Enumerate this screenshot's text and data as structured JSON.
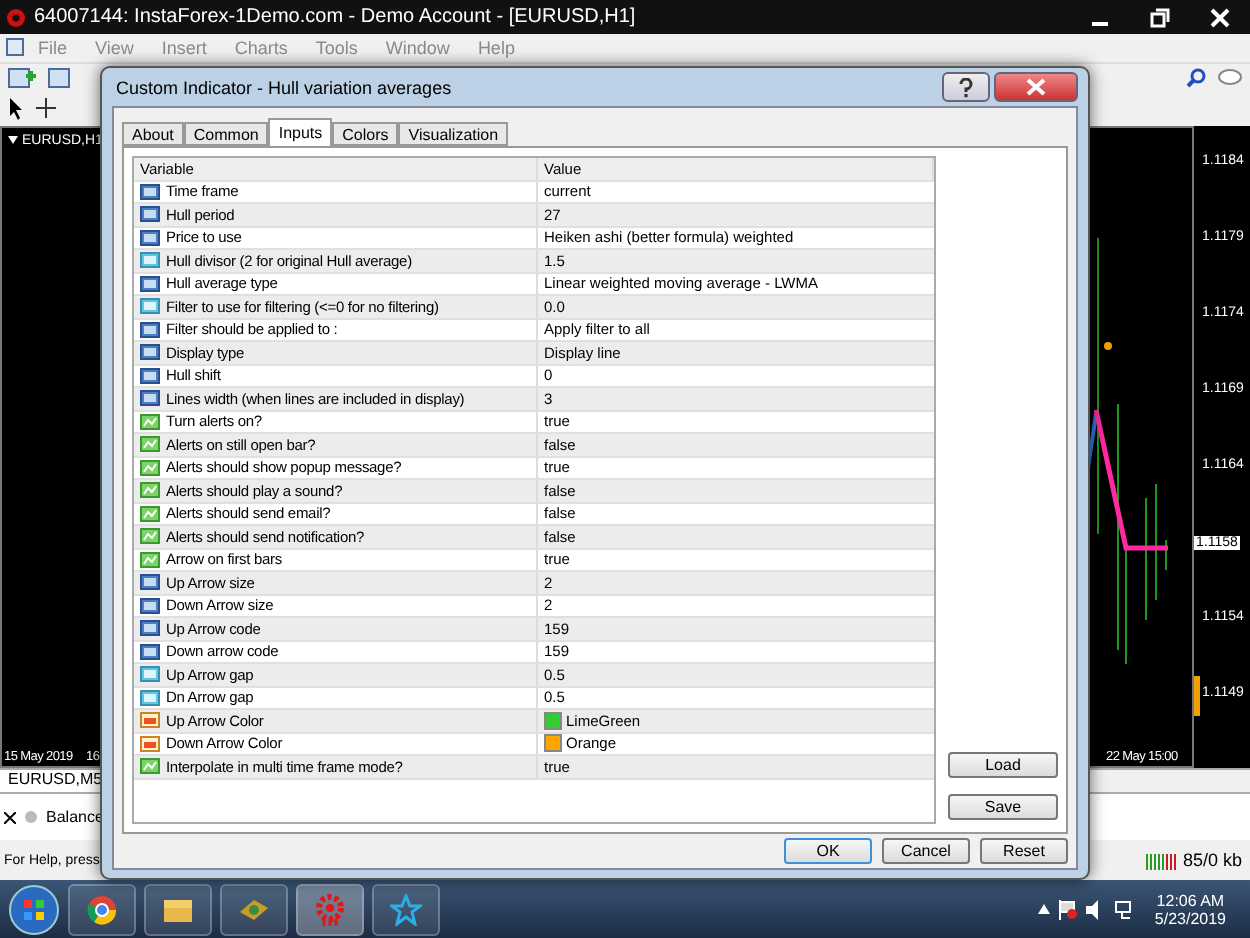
{
  "window": {
    "title": "64007144: InstaForex-1Demo.com - Demo Account - [EURUSD,H1]"
  },
  "menu": [
    "File",
    "View",
    "Insert",
    "Charts",
    "Tools",
    "Window",
    "Help"
  ],
  "chart": {
    "title": "EURUSD,H1",
    "price_scale": [
      "1.1184",
      "1.1179",
      "1.1174",
      "1.1169",
      "1.1164",
      "1.1154",
      "1.1149"
    ],
    "current_price": "1.1158",
    "dates": [
      "15 May 2019",
      "16",
      "22 May 15:00"
    ]
  },
  "chart_tabs": [
    {
      "label": "EURUSD,M5",
      "selected": true
    }
  ],
  "terminal": {
    "balance": "Balance"
  },
  "status_bar": {
    "help": "For Help, press",
    "traffic": "85/0 kb"
  },
  "dialog": {
    "title": "Custom Indicator - Hull variation averages",
    "tabs": [
      {
        "label": "About",
        "selected": false
      },
      {
        "label": "Common",
        "selected": false
      },
      {
        "label": "Inputs",
        "selected": true
      },
      {
        "label": "Colors",
        "selected": false
      },
      {
        "label": "Visualization",
        "selected": false
      }
    ],
    "columns": [
      "Variable",
      "Value"
    ],
    "rows": [
      {
        "kind": "int",
        "variable": "Time frame",
        "value": "current"
      },
      {
        "kind": "int",
        "variable": "Hull period",
        "value": "27"
      },
      {
        "kind": "int",
        "variable": "Price to use",
        "value": "Heiken ashi (better formula) weighted"
      },
      {
        "kind": "double",
        "variable": "Hull divisor (2 for original Hull average)",
        "value": "1.5"
      },
      {
        "kind": "int",
        "variable": "Hull average type",
        "value": "Linear weighted moving average - LWMA"
      },
      {
        "kind": "double",
        "variable": "Filter to use for filtering (<=0 for no filtering)",
        "value": "0.0"
      },
      {
        "kind": "int",
        "variable": "Filter should be applied to :",
        "value": "Apply filter to all"
      },
      {
        "kind": "int",
        "variable": "Display type",
        "value": "Display line"
      },
      {
        "kind": "int",
        "variable": "Hull shift",
        "value": "0"
      },
      {
        "kind": "int",
        "variable": "Lines width (when lines are included in display)",
        "value": "3"
      },
      {
        "kind": "bool",
        "variable": "Turn alerts on?",
        "value": "true"
      },
      {
        "kind": "bool",
        "variable": "Alerts on still open bar?",
        "value": "false"
      },
      {
        "kind": "bool",
        "variable": "Alerts should show popup message?",
        "value": "true"
      },
      {
        "kind": "bool",
        "variable": "Alerts should play a sound?",
        "value": "false"
      },
      {
        "kind": "bool",
        "variable": "Alerts should send email?",
        "value": "false"
      },
      {
        "kind": "bool",
        "variable": "Alerts should send notification?",
        "value": "false"
      },
      {
        "kind": "bool",
        "variable": "Arrow on first bars",
        "value": "true"
      },
      {
        "kind": "int",
        "variable": "Up Arrow size",
        "value": "2"
      },
      {
        "kind": "int",
        "variable": "Down Arrow size",
        "value": "2"
      },
      {
        "kind": "int",
        "variable": "Up Arrow code",
        "value": "159"
      },
      {
        "kind": "int",
        "variable": "Down arrow code",
        "value": "159"
      },
      {
        "kind": "double",
        "variable": "Up Arrow gap",
        "value": "0.5"
      },
      {
        "kind": "double",
        "variable": "Dn Arrow gap",
        "value": "0.5"
      },
      {
        "kind": "color",
        "variable": "Up Arrow Color",
        "value": "LimeGreen",
        "color": "#32cd32"
      },
      {
        "kind": "color",
        "variable": "Down Arrow Color",
        "value": "Orange",
        "color": "#ffa500"
      },
      {
        "kind": "bool",
        "variable": "Interpolate in multi time frame mode?",
        "value": "true"
      }
    ],
    "side_buttons": [
      "Load",
      "Save"
    ],
    "buttons": [
      {
        "label": "OK",
        "default": true
      },
      {
        "label": "Cancel",
        "default": false
      },
      {
        "label": "Reset",
        "default": false
      }
    ]
  },
  "taskbar": {
    "time": "12:06 AM",
    "date": "5/23/2019"
  }
}
